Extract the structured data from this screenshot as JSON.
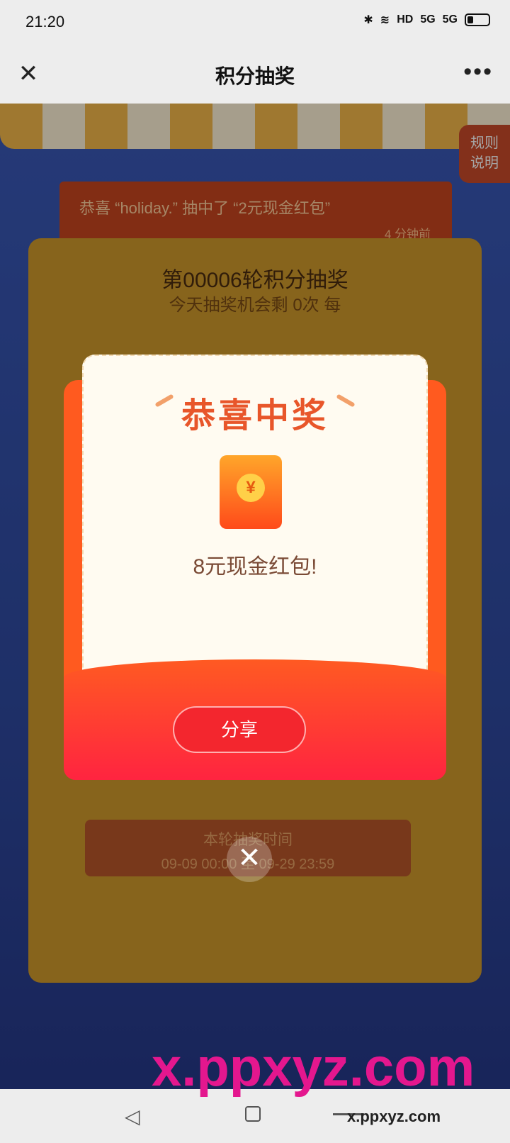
{
  "statusbar": {
    "time": "21:20",
    "hd": "HD",
    "signal1": "5G",
    "signal2": "5G"
  },
  "titlebar": {
    "title": "积分抽奖",
    "close_glyph": "✕",
    "more_glyph": "•••"
  },
  "rules_label": "规则\n说明",
  "banner": {
    "message": "恭喜 “holiday.” 抽中了 “2元现金红包”",
    "ago": "4 分钟前"
  },
  "machine": {
    "round_title": "第00006轮积分抽奖",
    "today_text": "今天抽奖机会剩 0次 每",
    "time_label": "本轮抽奖时间",
    "time_range": "09-09 00:00 至 09-29 23:59"
  },
  "modal": {
    "heading": "恭喜中奖",
    "yen": "¥",
    "prize": "8元现金红包!",
    "share_label": "分享"
  },
  "close_modal_glyph": "✕",
  "navbar": {
    "back_glyph": "◁"
  },
  "watermark": {
    "big": "x.ppxyz.com",
    "small": "x.ppxyz.com"
  }
}
